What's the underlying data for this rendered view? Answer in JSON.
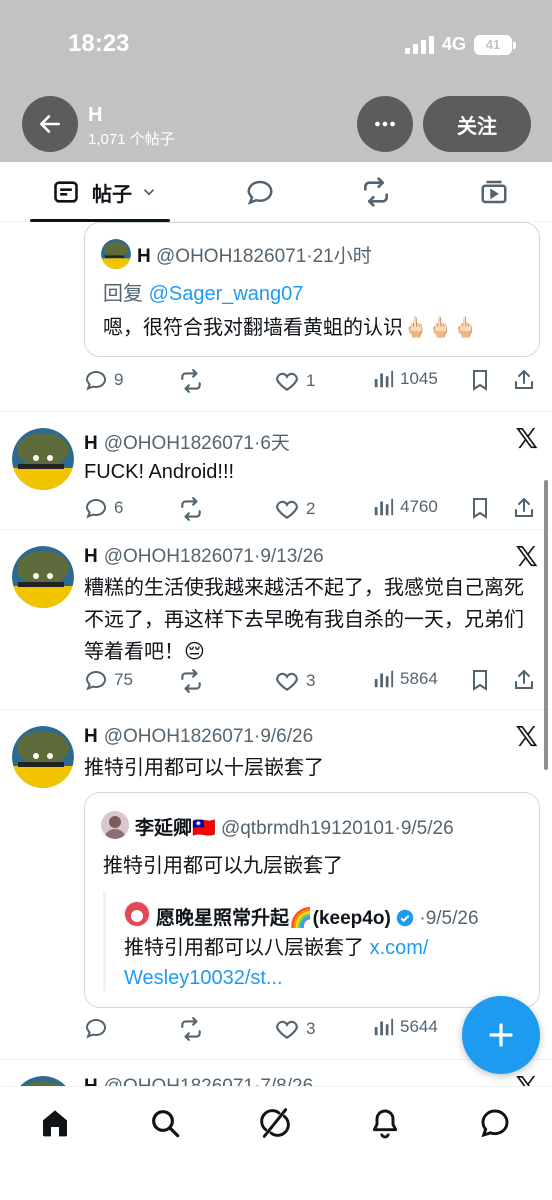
{
  "status_bar": {
    "time": "18:23",
    "network": "4G",
    "battery": "41"
  },
  "header": {
    "title": "H",
    "subtitle": "1,071 个帖子",
    "follow_label": "关注"
  },
  "tabs": [
    {
      "label": "帖子",
      "icon": "posts-icon"
    },
    {
      "label": "",
      "icon": "reply-icon"
    },
    {
      "label": "",
      "icon": "repost-icon"
    },
    {
      "label": "",
      "icon": "media-icon"
    }
  ],
  "posts": [
    {
      "quote": {
        "name": "H",
        "handle": "@OHOH1826071",
        "time": "21小时",
        "reply_prefix": "回复",
        "reply_to": "@Sager_wang07",
        "text": "嗯，很符合我对翻墙看黄蛆的认识🖕🏻🖕🏻🖕🏻"
      },
      "replies": "9",
      "reposts": "",
      "likes": "1",
      "views": "1045"
    },
    {
      "name": "H",
      "handle": "@OHOH1826071",
      "time": "6天",
      "text": "FUCK! Android!!!",
      "replies": "6",
      "reposts": "",
      "likes": "2",
      "views": "4760"
    },
    {
      "name": "H",
      "handle": "@OHOH1826071",
      "time": "9/13/26",
      "text": "糟糕的生活使我越来越活不起了，我感觉自己离死不远了，再这样下去早晚有我自杀的一天，兄弟们等着看吧！😔",
      "replies": "75",
      "reposts": "",
      "likes": "3",
      "views": "5864"
    },
    {
      "name": "H",
      "handle": "@OHOH1826071",
      "time": "9/6/26",
      "text": "推特引用都可以十层嵌套了",
      "quote": {
        "name": "李延卿🇹🇼",
        "handle": "@qtbrmdh19120101",
        "time": "9/5/26",
        "text": "推特引用都可以九层嵌套了",
        "inner": {
          "name": "愿晚星照常升起🌈(keep4o)",
          "time": "9/5/26",
          "text": "推特引用都可以八层嵌套了",
          "link1": "x.com/",
          "link2": "Wesley10032/st..."
        }
      },
      "replies": "",
      "reposts": "",
      "likes": "3",
      "views": "5644"
    },
    {
      "name": "H",
      "handle": "@OHOH1826071",
      "time": "7/8/26"
    }
  ],
  "bottom_nav": [
    "home-icon",
    "search-icon",
    "grok-icon",
    "notifications-icon",
    "messages-icon"
  ],
  "colors": {
    "accent": "#1d9bf0",
    "header_bg": "#c2c2c2",
    "button_bg": "#5c5c5c",
    "text": "#0f1419",
    "muted": "#536471"
  }
}
